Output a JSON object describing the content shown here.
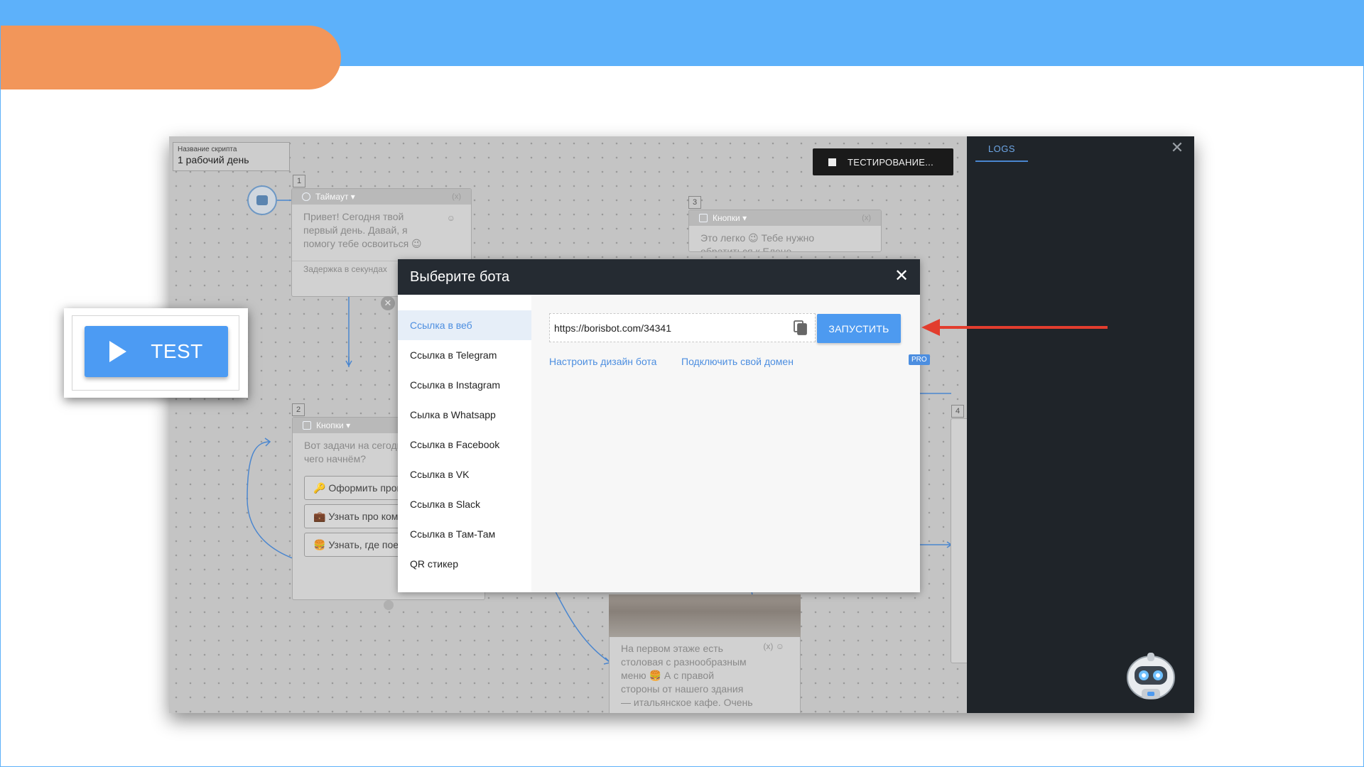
{
  "colors": {
    "top_band": "#5db1fa",
    "orange_pill": "#f2965a",
    "accent_blue": "#4d9af0",
    "link_blue": "#4c8ee0",
    "modal_header": "#252b32",
    "logs_bg": "#1f2429",
    "arrow_red": "#e23d2e"
  },
  "editor": {
    "script_name_label": "Название скрипта",
    "script_name_value": "1 рабочий день",
    "testing_button": "ТЕСТИРОВАНИЕ...",
    "block1": {
      "number": "1",
      "type": "Таймаут ▾",
      "meta": "(x)",
      "text": "Привет! Сегодня твой первый день. Давай, я помогу тебе освоиться 😉",
      "delay": "Задержка в секундах"
    },
    "block2": {
      "number": "2",
      "type": "Кнопки ▾",
      "text": "Вот задачи на сегодня, с чего начнём?",
      "buttons": [
        "🔑 Оформить пропуск",
        "💼 Узнать про компанию",
        "🍔 Узнать, где поесть"
      ]
    },
    "block3": {
      "number": "3",
      "type": "Кнопки ▾",
      "meta": "(x)",
      "text": "Это легко 😉 Тебе нужно обратиться к Елене"
    },
    "block4": {
      "number": "4"
    },
    "block5": {
      "meta": "(x)",
      "text": "На первом этаже есть столовая с разнообразным меню 🍔 А с правой стороны от нашего здания — итальянское кафе. Очень"
    }
  },
  "logs": {
    "tab": "LOGS",
    "close_icon": "close-icon"
  },
  "modal": {
    "title": "Выберите бота",
    "close_icon": "close-icon",
    "sidebar": [
      {
        "label": "Ссылка в веб",
        "active": true
      },
      {
        "label": "Ссылка в Telegram",
        "active": false
      },
      {
        "label": "Ссылка в Instagram",
        "active": false
      },
      {
        "label": "Сылка в Whatsapp",
        "active": false
      },
      {
        "label": "Ссылка в Facebook",
        "active": false
      },
      {
        "label": "Ссылка в VK",
        "active": false
      },
      {
        "label": "Ссылка в Slack",
        "active": false
      },
      {
        "label": "Ссылка в Там-Там",
        "active": false
      },
      {
        "label": "QR стикер",
        "active": false
      }
    ],
    "url_value": "https://borisbot.com/34341",
    "run_button": "ЗАПУСТИТЬ",
    "link_design": "Настроить дизайн бота",
    "link_domain": "Подключить свой домен",
    "pro_badge": "PRO"
  },
  "callout": {
    "test_button": "TEST"
  }
}
